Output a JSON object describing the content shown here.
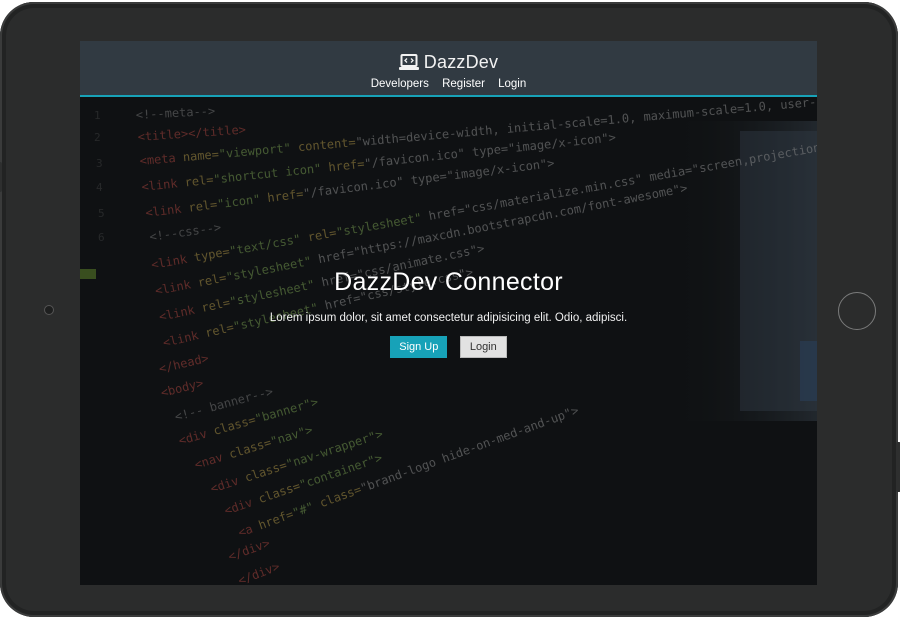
{
  "navbar": {
    "brand": "DazzDev",
    "brand_icon": "laptop-code-icon",
    "links": [
      "Developers",
      "Register",
      "Login"
    ]
  },
  "hero": {
    "title": "DazzDev Connector",
    "lead": "Lorem ipsum dolor, sit amet consectetur adipisicing elit. Odio, adipisci.",
    "signup_label": "Sign Up",
    "login_label": "Login"
  },
  "theme": {
    "accent": "#17a2b8",
    "navbar_bg": "#313a42"
  }
}
